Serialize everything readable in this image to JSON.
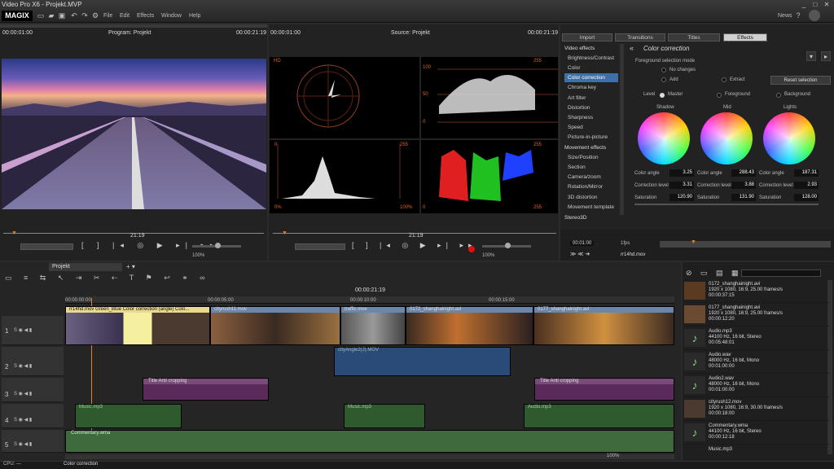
{
  "app": {
    "title": "Video Pro X6 - Projekt.MVP",
    "logo": "MAGIX",
    "news": "News"
  },
  "menu": [
    "File",
    "Edit",
    "Effects",
    "Window",
    "Help"
  ],
  "program": {
    "tc_left": "00:00:01:00",
    "title": "Program: Projekt",
    "tc_right": "00:00:21:19",
    "pos": "21:19",
    "zoom": "100%"
  },
  "source": {
    "tc_left": "00:00:01:00",
    "title": "Source: Projekt",
    "tc_right": "00:00:21:19",
    "pos": "21:19",
    "zoom": "100%"
  },
  "scopes": {
    "hd": "HD",
    "lbl_255a": "255",
    "lbl_100": "100",
    "lbl_50": "50",
    "lbl_0": "0",
    "lbl_0b": "0",
    "lbl_255b": "255",
    "hist_0": "0%",
    "hist_100": "100%",
    "lbl_255c": "255",
    "lbl_255d": "255",
    "lbl_0c": "0"
  },
  "tabs": [
    "Import",
    "Transitions",
    "Titles",
    "Effects"
  ],
  "video_effects": {
    "header": "Video effects",
    "items": [
      "Brightness/Contrast",
      "Color",
      "Color correction",
      "Chroma key",
      "Art filter",
      "Distortion",
      "Sharpness",
      "Speed",
      "Picture-in-picture"
    ]
  },
  "movement_effects": {
    "header": "Movement effects",
    "items": [
      "Size/Position",
      "Section",
      "Camera/zoom",
      "Rotation/Mirror",
      "3D distortion",
      "Movement template"
    ]
  },
  "stereo": "Stereo3D",
  "cc": {
    "title": "Color correction",
    "fg_mode": "Foreground selection mode",
    "no_changes": "No changes",
    "add": "Add",
    "extract": "Extract",
    "reset": "Reset selection",
    "level": "Level",
    "master": "Master",
    "foreground": "Foreground",
    "background": "Background",
    "wheels": [
      {
        "name": "Shadow",
        "angle_lbl": "Color angle",
        "angle": "3.25",
        "corr_lbl": "Correction level",
        "corr": "3.31",
        "sat_lbl": "Saturation",
        "sat": "120.90"
      },
      {
        "name": "Mid",
        "angle_lbl": "Color angle",
        "angle": "288.43",
        "corr_lbl": "Correction level",
        "corr": "3.88",
        "sat_lbl": "Saturation",
        "sat": "131.90"
      },
      {
        "name": "Lights",
        "angle_lbl": "Color angle",
        "angle": "187.31",
        "corr_lbl": "Correction level",
        "corr": "2.93",
        "sat_lbl": "Saturation",
        "sat": "128.00"
      }
    ],
    "mini_tc": "00:01:00",
    "mini_file": "rr14hd.mov",
    "mini_zoom": "1fps"
  },
  "timeline": {
    "tab": "Projekt",
    "tc": "00:00:21:19",
    "ruler": [
      "00:00:00:00",
      "00:00:05:00",
      "00:00:10:00",
      "00:00:15:00"
    ],
    "zoom": "100%"
  },
  "tracks": [
    {
      "num": "1"
    },
    {
      "num": "2"
    },
    {
      "num": "3"
    },
    {
      "num": "4"
    },
    {
      "num": "5"
    }
  ],
  "clips": {
    "t1a": "rr14hd.mov  Green_Blue  Color correction (angle)  Colo...",
    "t1b": "cityrush11.mov",
    "t1c": "traffic.mov",
    "t1d": "0172_shanghainight.avi",
    "t1e": "0177_shanghainight.avi",
    "t2": "cityAngle2(J).MOV",
    "t3a": "Title   Anti cropping",
    "t3b": "Title   Anti cropping",
    "t4a": "Music.mp3",
    "t4b": "Music.mp3",
    "t4c": "Audio.mp3",
    "t5": "Commentary.wma"
  },
  "media": [
    {
      "name": "0172_shanghainight.avi",
      "l1": "1920 x 1080, 16:9, 25.00 frames/s",
      "l2": "00:00:37:15"
    },
    {
      "name": "0177_shanghainight.avi",
      "l1": "1920 x 1080, 16:9, 25.00 frames/s",
      "l2": "00:00:12:20"
    },
    {
      "name": "Audio.mp3",
      "l1": "44100 Hz, 16 bit, Stereo",
      "l2": "00:05:48:01"
    },
    {
      "name": "Audio.wav",
      "l1": "48000 Hz, 16 bit, Mono",
      "l2": "00:01:00:00"
    },
    {
      "name": "Audio2.wav",
      "l1": "48000 Hz, 16 bit, Mono",
      "l2": "00:01:00:00"
    },
    {
      "name": "cityrush12.mov",
      "l1": "1920 x 1080, 16:9, 30.00 frames/s",
      "l2": "00:00:18:00"
    },
    {
      "name": "Commentary.wma",
      "l1": "44100 Hz, 16 bit, Stereo",
      "l2": "00:00:12:18"
    },
    {
      "name": "Music.mp3",
      "l1": "",
      "l2": ""
    }
  ],
  "status": {
    "cpu": "CPU: —",
    "msg": "Color correction"
  }
}
